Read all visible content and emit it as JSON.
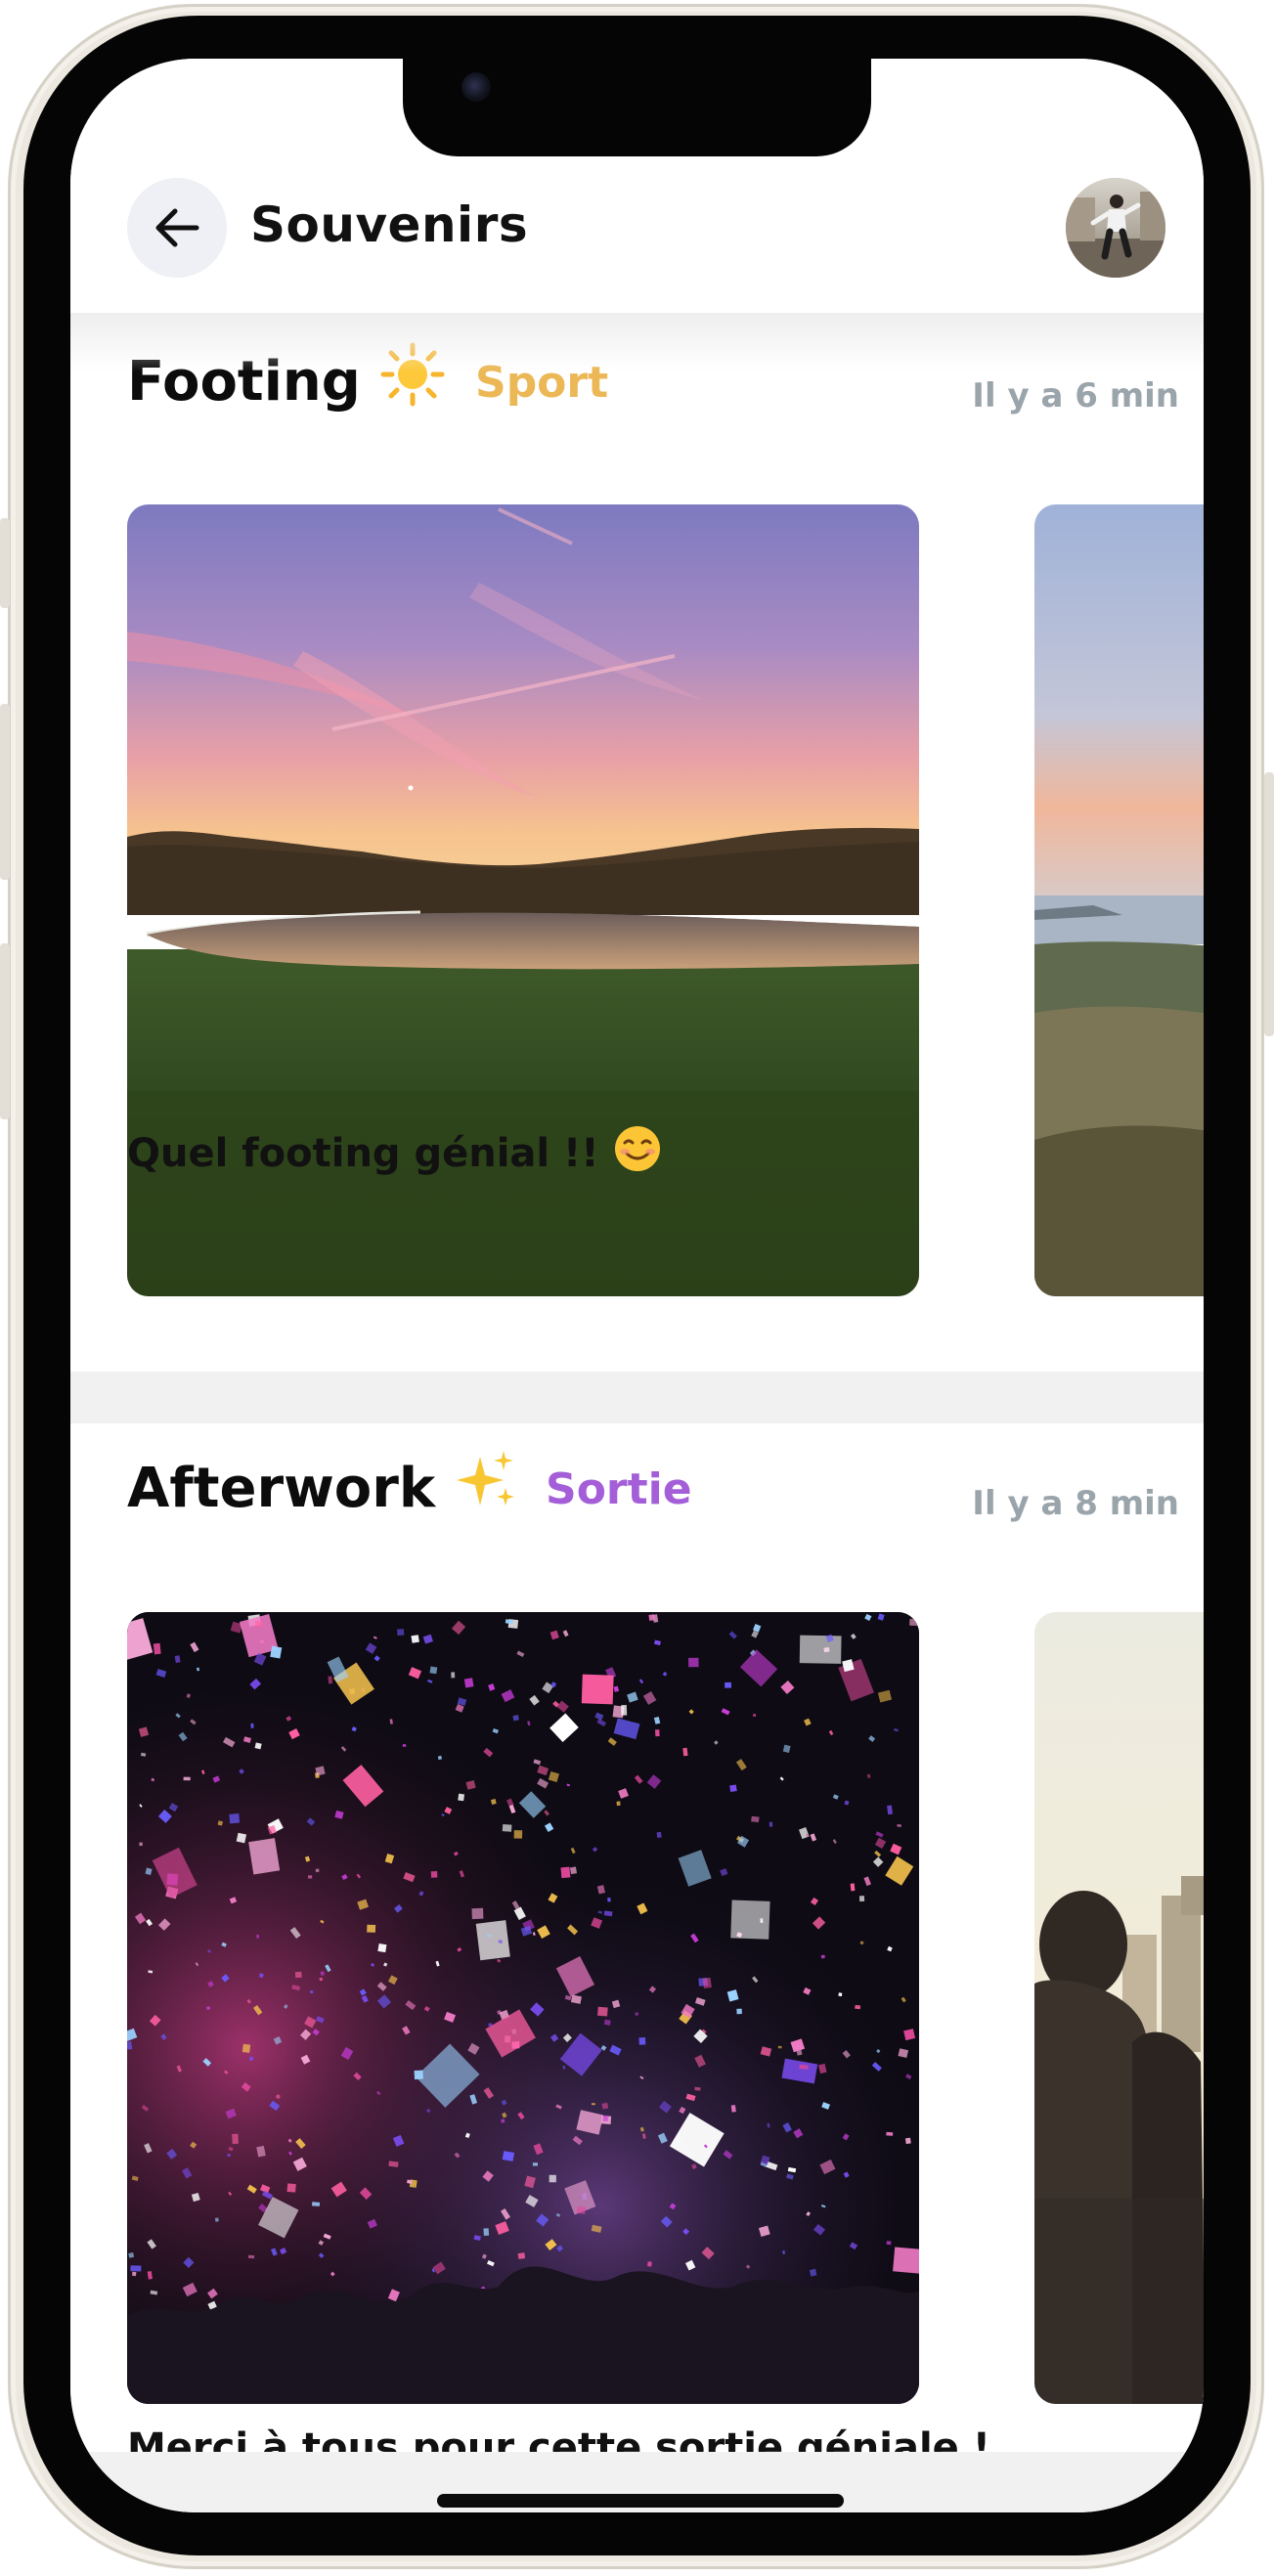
{
  "header": {
    "title": "Souvenirs",
    "back_icon": "arrow-left-icon",
    "avatar": "user-avatar"
  },
  "memories": [
    {
      "title": "Footing",
      "emoji": "sun-emoji",
      "category": "Sport",
      "category_color": "#ebb855",
      "time": "Il y a 6 min",
      "caption": "Quel footing génial !!",
      "caption_emoji": "smiling-face-emoji",
      "photos": [
        "sunset-park-lake-photo",
        "coastal-sunset-photo"
      ]
    },
    {
      "title": "Afterwork",
      "emoji": "sparkles-emoji",
      "category": "Sortie",
      "category_color": "#a45fd8",
      "time": "Il y a 8 min",
      "caption": "Merci à tous pour cette sortie géniale !",
      "photos": [
        "confetti-concert-photo",
        "city-friends-photo"
      ]
    }
  ],
  "colors": {
    "back_button_bg": "#eef0f6",
    "timestamp": "#9aa4ab",
    "section_divider": "#f1f1f2"
  }
}
